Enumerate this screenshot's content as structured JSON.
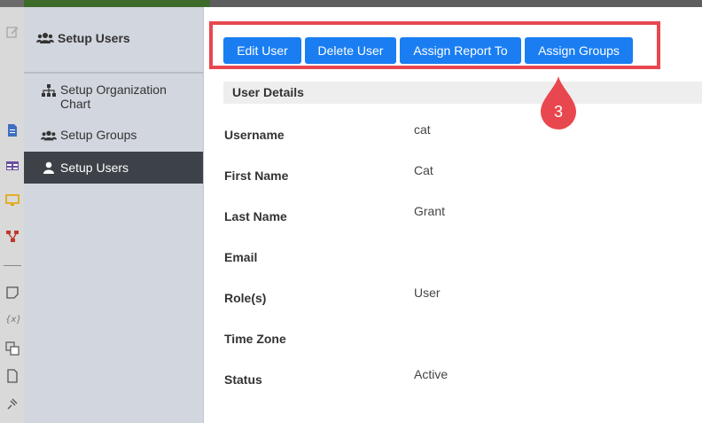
{
  "sidebar": {
    "header": "Setup Users",
    "items": [
      {
        "label": "Setup Organization Chart",
        "icon": "sitemap-icon",
        "active": false
      },
      {
        "label": "Setup Groups",
        "icon": "users-group-icon",
        "active": false
      },
      {
        "label": "Setup Users",
        "icon": "user-icon",
        "active": true
      }
    ]
  },
  "toolbar": {
    "edit_label": "Edit User",
    "delete_label": "Delete User",
    "assign_report_label": "Assign Report To",
    "assign_groups_label": "Assign Groups"
  },
  "callout": {
    "number": "3",
    "color": "#e8474f"
  },
  "details": {
    "title": "User Details",
    "fields": [
      {
        "label": "Username",
        "value": "cat"
      },
      {
        "label": "First Name",
        "value": "Cat"
      },
      {
        "label": "Last Name",
        "value": "Grant"
      },
      {
        "label": "Email",
        "value": ""
      },
      {
        "label": "Role(s)",
        "value": "User"
      },
      {
        "label": "Time Zone",
        "value": ""
      },
      {
        "label": "Status",
        "value": "Active"
      }
    ]
  },
  "colors": {
    "accent": "#1a7ef2",
    "sidebar_active": "#3c4247",
    "highlight": "#e8474f"
  }
}
